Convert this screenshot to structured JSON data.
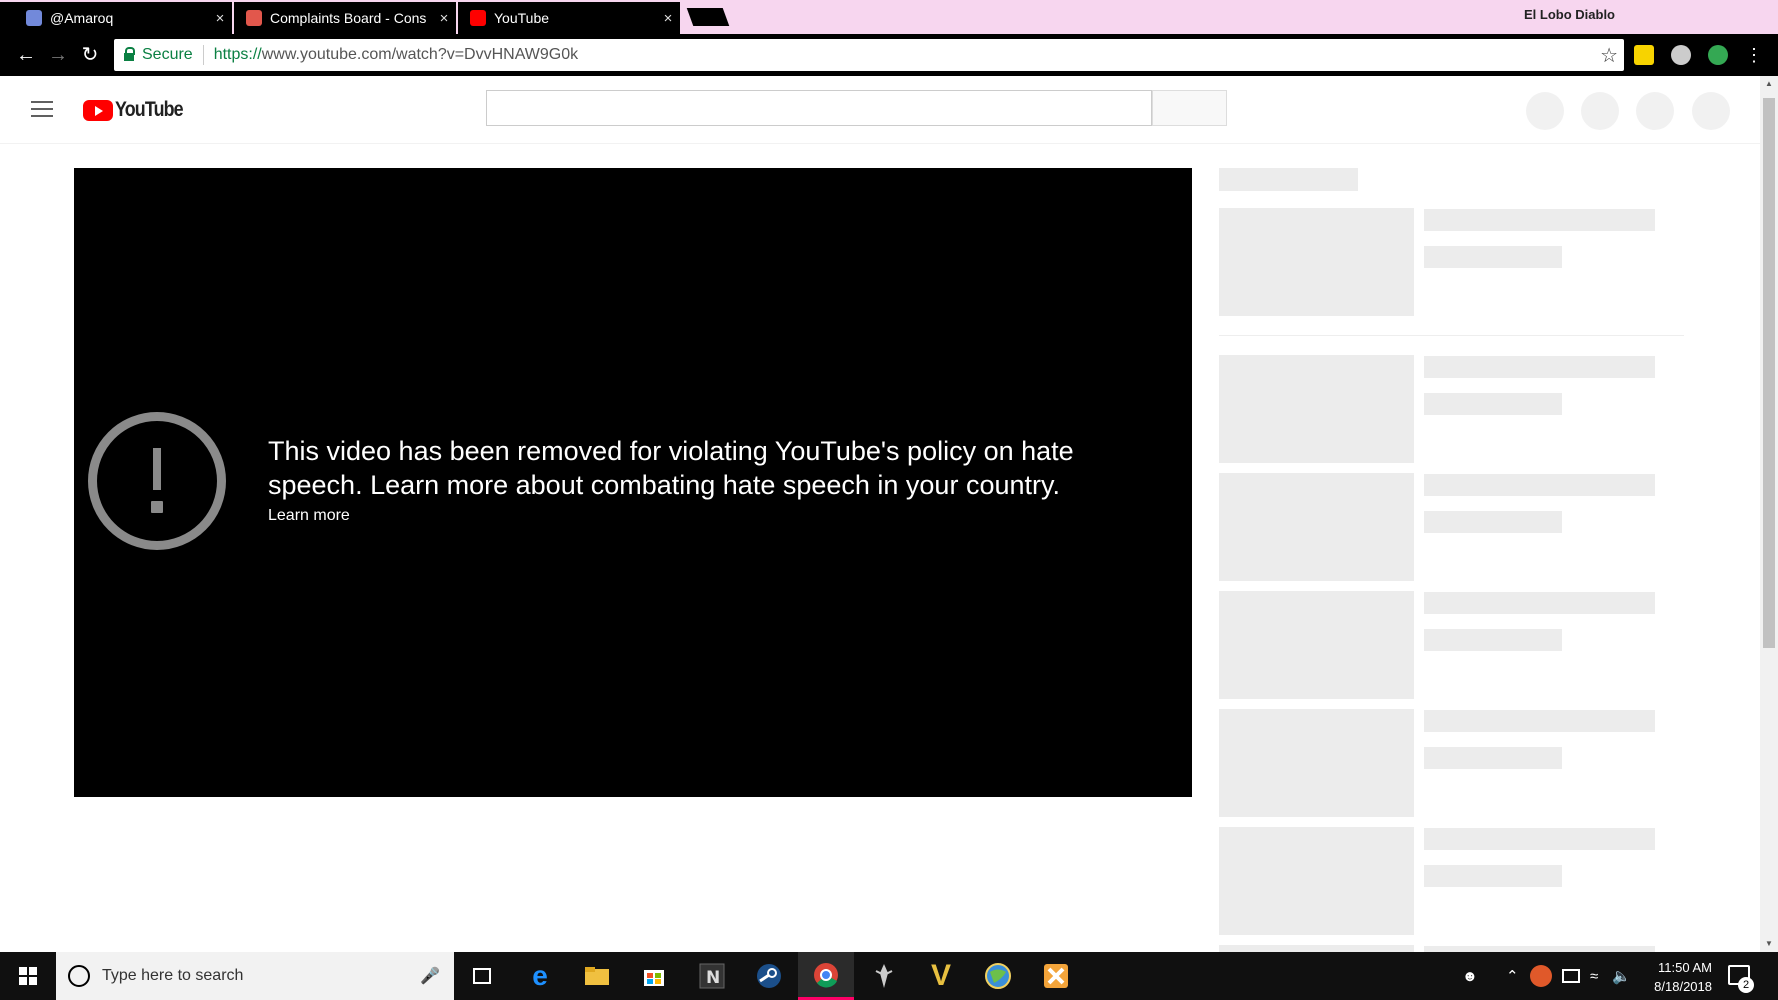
{
  "browser": {
    "tabs": [
      {
        "label": "@Amaroq",
        "favicon_color": "#7289da",
        "active": false
      },
      {
        "label": "Complaints Board - Cons",
        "favicon_color": "#e2574c",
        "active": false
      },
      {
        "label": "YouTube",
        "favicon_color": "#ff0000",
        "active": true
      }
    ],
    "close_glyph": "×",
    "profile_name": "El Lobo Diablo",
    "secure_label": "Secure",
    "url_scheme": "https://",
    "url_rest": "www.youtube.com/watch?v=DvvHNAW9G0k",
    "extensions": [
      {
        "icon": "w-extension-icon",
        "color": "#f7d300"
      },
      {
        "icon": "profile-extension-icon",
        "color": "#cccccc"
      },
      {
        "icon": "green-search-extension-icon",
        "color": "#34a853"
      }
    ]
  },
  "youtube": {
    "logo_text": "YouTube",
    "player": {
      "error_message": "This video has been removed for violating YouTube's policy on hate speech. Learn more about combating hate speech in your country.",
      "learn_more": "Learn more"
    }
  },
  "taskbar": {
    "search_placeholder": "Type here to search",
    "apps": [
      "task-view-icon",
      "edge-icon",
      "file-explorer-icon",
      "store-icon",
      "n-app-icon",
      "steam-icon",
      "chrome-icon",
      "skyrim-icon",
      "v-app-icon",
      "globe-app-icon",
      "cross-app-icon"
    ],
    "active_app": "chrome-icon",
    "time": "11:50 AM",
    "date": "8/18/2018",
    "notification_count": "2"
  },
  "colors": {
    "accent_red": "#ff0000",
    "secure_green": "#0b8043",
    "skeleton_gray": "#ececec"
  }
}
